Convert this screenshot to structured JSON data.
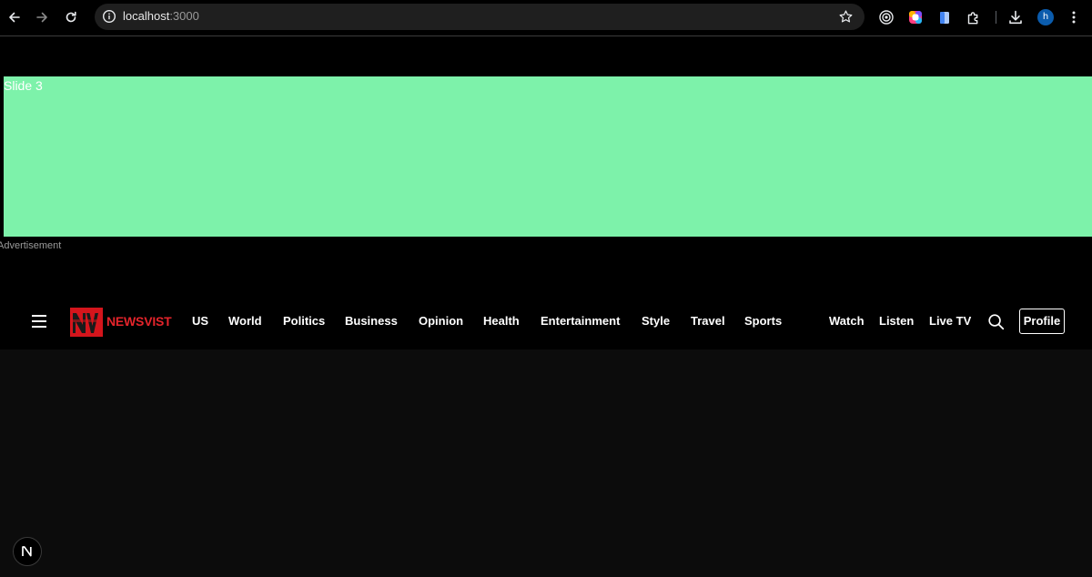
{
  "browser": {
    "url_host": "localhost",
    "url_port": ":3000",
    "profile_initial": "h",
    "icons": {
      "back": "arrow-left-icon",
      "forward": "arrow-right-icon",
      "reload": "reload-icon",
      "site_info": "info-icon",
      "bookmark": "star-icon",
      "extensions": [
        "target-icon",
        "color-ring-icon",
        "clipboard-icon",
        "puzzle-icon",
        "download-icon"
      ],
      "menu": "kebab-menu-icon"
    }
  },
  "slider": {
    "label": "Slide 3",
    "background": "#7df2aa"
  },
  "advertisement": {
    "label": "Advertisement"
  },
  "header": {
    "brand": "NEWSVIST",
    "brand_color": "#e3242b",
    "nav": [
      "US",
      "World",
      "Politics",
      "Business",
      "Opinion",
      "Health",
      "Entertainment",
      "Style",
      "Travel",
      "Sports"
    ],
    "right_links": [
      "Watch",
      "Listen",
      "Live TV"
    ],
    "profile_label": "Profile",
    "icons": {
      "menu": "hamburger-icon",
      "search": "search-icon"
    }
  },
  "dev_badge": {
    "letter": "N"
  }
}
